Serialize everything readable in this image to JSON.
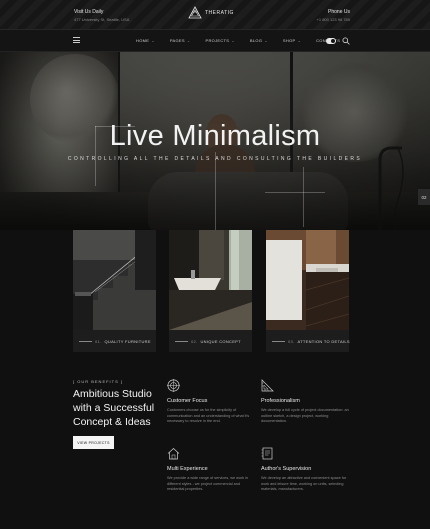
{
  "topbar": {
    "visit_title": "Visit Us Daily",
    "visit_address": "477 University St, Seattle, USA",
    "brand": "THERATIG",
    "phone_title": "Phone Us",
    "phone_number": "+1 800 123 98 789"
  },
  "nav": {
    "items": [
      {
        "label": "HOME"
      },
      {
        "label": "PAGES"
      },
      {
        "label": "PROJECTS"
      },
      {
        "label": "BLOG"
      },
      {
        "label": "SHOP"
      },
      {
        "label": "CONTACTS"
      }
    ]
  },
  "hero": {
    "title": "Live Minimalism",
    "subtitle": "CONTROLLING ALL THE DETAILS AND CONSULTING THE BUILDERS",
    "side_tab": "02"
  },
  "cards": [
    {
      "num": "01.",
      "label": "QUALITY FURNITURE"
    },
    {
      "num": "02.",
      "label": "UNIQUE CONCEPT"
    },
    {
      "num": "03.",
      "label": "ATTENTION TO DETAILS"
    }
  ],
  "about": {
    "kicker": "[ OUR BENEFITS ]",
    "heading": "Ambitious Studio with a Successful Concept & Ideas",
    "button": "VIEW PROJECTS"
  },
  "features": [
    {
      "icon": "target-icon",
      "title": "Customer Focus",
      "text": "Customers choose us for the simplicity of communication and an understanding of what it's necessary to resolve in the end."
    },
    {
      "icon": "set-square-icon",
      "title": "Professionalism",
      "text": "We develop a full cycle of project documentation: an outline sketch, a design project, working documentation."
    },
    {
      "icon": "house-icon",
      "title": "Multi Experience",
      "text": "We provide a wide range of services, we work in different styles - we project commercial and residential properties."
    },
    {
      "icon": "document-icon",
      "title": "Author's Supervision",
      "text": "We develop an attractive and convenient space for work and leisure time, working on units, selecting materials, manufacturers."
    }
  ]
}
